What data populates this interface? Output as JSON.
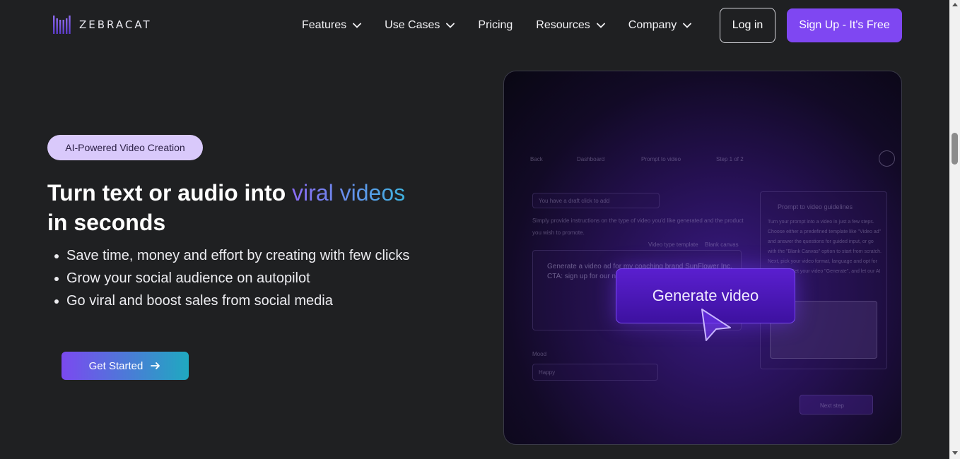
{
  "brand": {
    "name": "ZEBRACAT",
    "logo_icon": "zebracat-logo-icon",
    "accent": "#7f47f2"
  },
  "nav": {
    "items": [
      {
        "label": "Features",
        "has_dropdown": true
      },
      {
        "label": "Use Cases",
        "has_dropdown": true
      },
      {
        "label": "Pricing",
        "has_dropdown": false
      },
      {
        "label": "Resources",
        "has_dropdown": true
      },
      {
        "label": "Company",
        "has_dropdown": true
      }
    ],
    "login_label": "Log in",
    "signup_label": "Sign Up - It's Free"
  },
  "hero": {
    "badge": "AI-Powered Video Creation",
    "headline_start": "Turn text or audio into ",
    "headline_highlight": "viral videos",
    "headline_end": "in seconds",
    "bullets": [
      "Save time, money and effort by creating with few clicks",
      "Grow your social audience on autopilot",
      "Go viral and boost sales from social media"
    ],
    "cta_label": "Get Started",
    "cta_icon": "arrow-right-icon"
  },
  "preview": {
    "breadcrumb": [
      "Back",
      "Dashboard",
      "Prompt to video",
      "Step 1 of 2"
    ],
    "draft_notice": "You have a draft click to add",
    "instructions": "Simply provide instructions on the type of video you'd like generated and the product you wish to promote.",
    "tabs": [
      "Video type template",
      "Blank canvas"
    ],
    "prompt_text": "Generate a video ad for my coaching brand SunFlower Inc. CTA: sign up for our ne",
    "guidelines_title": "Prompt to video guidelines",
    "guidelines_text": "Turn your prompt into a video in just a few steps. Choose either a predefined template like \"Video ad\" and answer the questions for guided input, or go with the \"Blank Canvas\" option to start from scratch. Next, pick your video format, language and opt for voiceover. Set your video \"Generate\", and let our AI handle the",
    "generate_label": "Generate video",
    "mood_label": "Mood",
    "mood_value": "Happy",
    "next_label": "Next step"
  }
}
